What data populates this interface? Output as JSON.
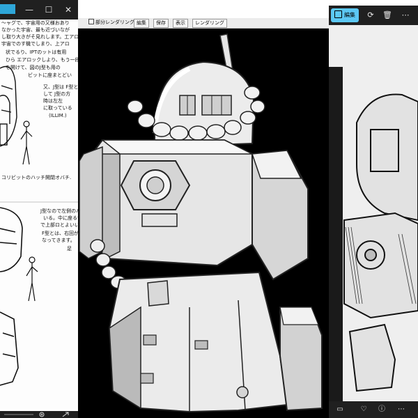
{
  "left_window": {
    "titlebar": {
      "minimize_glyph": "—",
      "maximize_glyph": "☐",
      "close_glyph": "✕"
    },
    "sketch_notes": [
      "〜ャグで、宇宙用の又様おあり",
      "なかった宇宙、最も近づいなが",
      "し取り大きがそ見れします。工アロ",
      "宇宙でのす機でしまり、上アロ",
      "状でるり、IPTのットは有用",
      "ひら エアロックしより、もう一段",
      "を開けて、図のJ型も用の",
      "ビットに座まとどい",
      "又、J型は F型と",
      "して J型の方",
      "時は左左",
      "に取っている",
      "(ILLIM.)"
    ],
    "sketch_caption_1": "コリビットのハッチ開閉オバチ.",
    "sketch_notes_2": [
      "J型なので左側のハッチ",
      "いる。中に座るつ",
      "で上部ロとよいいです。",
      "F型とは、右回が開",
      "なってきます。",
      "足"
    ],
    "statusbar_icons": [
      "zoom-in-icon",
      "fullscreen-icon"
    ]
  },
  "middle_window": {
    "menubar": {
      "partial_render_label": "部分レンダリング",
      "edit_label": "編集",
      "save_label": "保存",
      "view_label": "表示",
      "render_label": "レンダリング"
    }
  },
  "right_window": {
    "toolbar": {
      "edit_label": "編集",
      "rotate_glyph": "⟳",
      "delete_glyph": "🗑",
      "more_glyph": "⋯"
    },
    "bottombar": {
      "filmstrip_glyph": "▭",
      "favorite_glyph": "♡",
      "info_glyph": "ⓘ",
      "more_glyph": "⋯"
    }
  },
  "colors": {
    "accent": "#5cc8f5",
    "titlebar": "#202020",
    "canvas": "#000000"
  }
}
